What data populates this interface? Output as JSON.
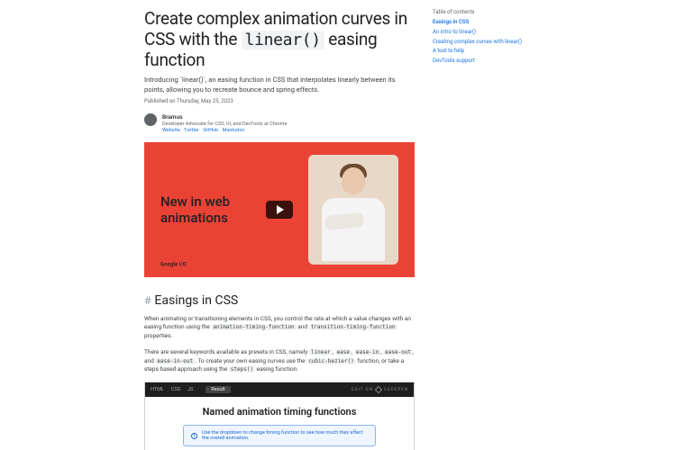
{
  "title_pre": "Create complex animation curves in CSS with the ",
  "title_code": "linear()",
  "title_post": " easing function",
  "subtitle": "Introducing `linear()`, an easing function in CSS that interpolates linearly between its points, allowing you to recreate bounce and spring effects.",
  "published": "Published on Thursday, May 25, 2023",
  "author": {
    "name": "Bramus",
    "role": "Developer Advocate for CSS, UI, and DevTools at Chrome",
    "links": [
      "Website",
      "Twitter",
      "GitHub",
      "Mastodon"
    ]
  },
  "video": {
    "headline": "New in web animations",
    "logo": "Google I/O"
  },
  "section1_heading": "Easings in CSS",
  "para1_a": "When animating or transitioning elements in CSS, you control the rate at which a value changes with an easing function using the ",
  "para1_code1": "animation-timing-function",
  "para1_b": " and ",
  "para1_code2": "transition-timing-function",
  "para1_c": " properties.",
  "para2_a": "There are several keywords available as presets in CSS, namely ",
  "para2_k": [
    "linear",
    "ease",
    "ease-in",
    "ease-out",
    "ease-in-out"
  ],
  "para2_b": ". To create your own easing curves use the ",
  "para2_code1": "cubic-bezier()",
  "para2_c": " function, or take a steps based approach using the ",
  "para2_code2": "steps()",
  "para2_d": " easing function.",
  "codepen": {
    "tabs": [
      "HTML",
      "CSS",
      "JS"
    ],
    "result_tab": "Result",
    "brand_prefix": "EDIT ON",
    "brand": "CODEPEN",
    "title": "Named animation timing functions",
    "note": "Use the dropdown to change timing function to see how much they affect the overall animation."
  },
  "toc": {
    "title": "Table of contents",
    "items": [
      "Easings in CSS",
      "An intro to linear()",
      "Creating complex curves with linear()",
      "A tool to help",
      "DevTools support"
    ]
  }
}
